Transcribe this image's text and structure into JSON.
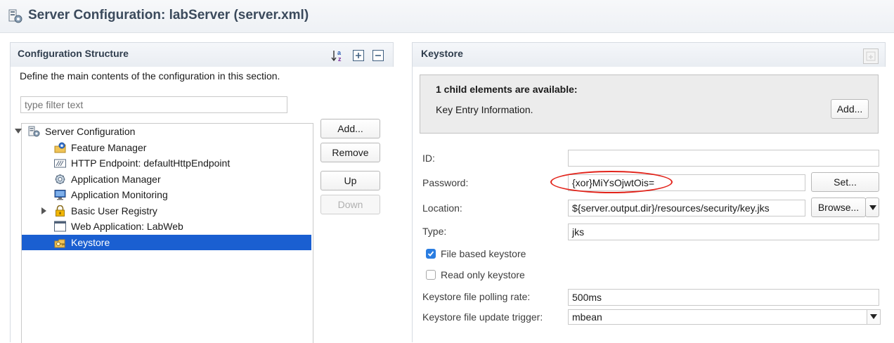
{
  "window": {
    "title": "Server Configuration: labServer (server.xml)"
  },
  "structure": {
    "title": "Configuration Structure",
    "description": "Define the main contents of the configuration in this section.",
    "filter_placeholder": "type filter text",
    "tree": [
      {
        "label": "Server Configuration",
        "icon": "server-config-icon",
        "level": 0,
        "expander": "expanded"
      },
      {
        "label": "Feature Manager",
        "icon": "feature-manager-icon",
        "level": 1,
        "expander": "none"
      },
      {
        "label": "HTTP Endpoint: defaultHttpEndpoint",
        "icon": "http-endpoint-icon",
        "level": 1,
        "expander": "none"
      },
      {
        "label": "Application Manager",
        "icon": "application-manager-icon",
        "level": 1,
        "expander": "none"
      },
      {
        "label": "Application Monitoring",
        "icon": "monitor-icon",
        "level": 1,
        "expander": "none"
      },
      {
        "label": "Basic User Registry",
        "icon": "lock-icon",
        "level": 1,
        "expander": "collapsed"
      },
      {
        "label": "Web Application: LabWeb",
        "icon": "web-application-icon",
        "level": 1,
        "expander": "none"
      },
      {
        "label": "Keystore",
        "icon": "keystore-icon",
        "level": 1,
        "expander": "none",
        "selected": true
      }
    ],
    "buttons": {
      "add": "Add...",
      "remove": "Remove",
      "up": "Up",
      "down": "Down"
    },
    "toolbar_icons": [
      "sort-az-icon",
      "expand-all-icon",
      "collapse-all-icon"
    ]
  },
  "keystore": {
    "title": "Keystore",
    "child_info": {
      "heading": "1 child elements are available:",
      "item": "Key Entry Information.",
      "add_button": "Add..."
    },
    "fields": {
      "id": {
        "label": "ID:",
        "value": ""
      },
      "password": {
        "label": "Password:",
        "value": "{xor}MiYsOjwtOis=",
        "button": "Set..."
      },
      "location": {
        "label": "Location:",
        "value": "${server.output.dir}/resources/security/key.jks",
        "button": "Browse..."
      },
      "type": {
        "label": "Type:",
        "value": "jks"
      },
      "file_based": {
        "label": "File based keystore",
        "checked": true
      },
      "read_only": {
        "label": "Read only keystore",
        "checked": false
      },
      "polling_rate": {
        "label": "Keystore file polling rate:",
        "value": "500ms"
      },
      "update_trigger": {
        "label": "Keystore file update trigger:",
        "value": "mbean"
      }
    }
  },
  "colors": {
    "selection": "#1a5fd1",
    "annotation": "#e2231a",
    "checkbox": "#2a7de1"
  }
}
